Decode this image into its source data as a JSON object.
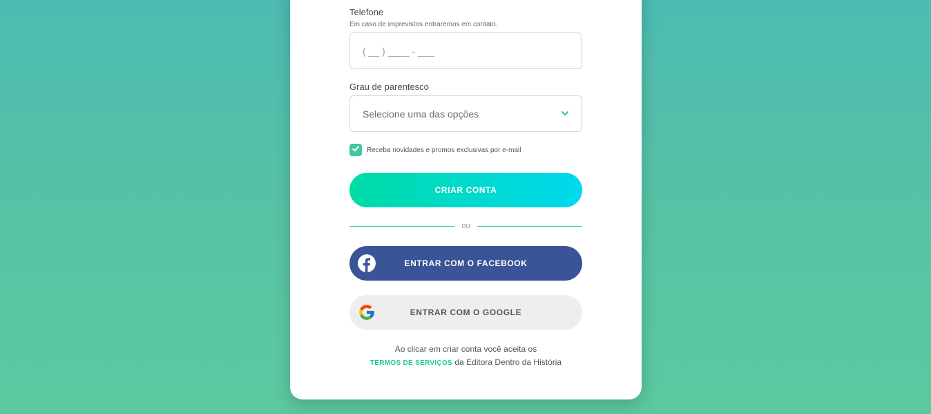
{
  "phone": {
    "label": "Telefone",
    "hint": "Em caso de imprevistos entraremos em contato.",
    "placeholder": "( __ ) ____ - ___"
  },
  "relationship": {
    "label": "Grau de parentesco",
    "selected": "Selecione uma das opções"
  },
  "newsletter": {
    "label": "Receba novidades e promos exclusivas por e-mail",
    "checked": true
  },
  "buttons": {
    "create_account": "CRIAR CONTA",
    "divider": "ou",
    "facebook": "ENTRAR COM O FACEBOOK",
    "google": "ENTRAR COM O GOOGLE"
  },
  "terms": {
    "line1": "Ao clicar em criar conta você aceita os",
    "link": "TERMOS DE SERVIÇOS",
    "line2": " da Editora Dentro da História"
  },
  "colors": {
    "accent": "#3ec7a0",
    "facebook": "#3b5497",
    "primary_gradient_start": "#00dba6",
    "primary_gradient_end": "#00d8f0"
  },
  "icons": {
    "select": "chevron-down-icon",
    "checkbox": "check-icon",
    "facebook": "facebook-icon",
    "google": "google-icon"
  }
}
